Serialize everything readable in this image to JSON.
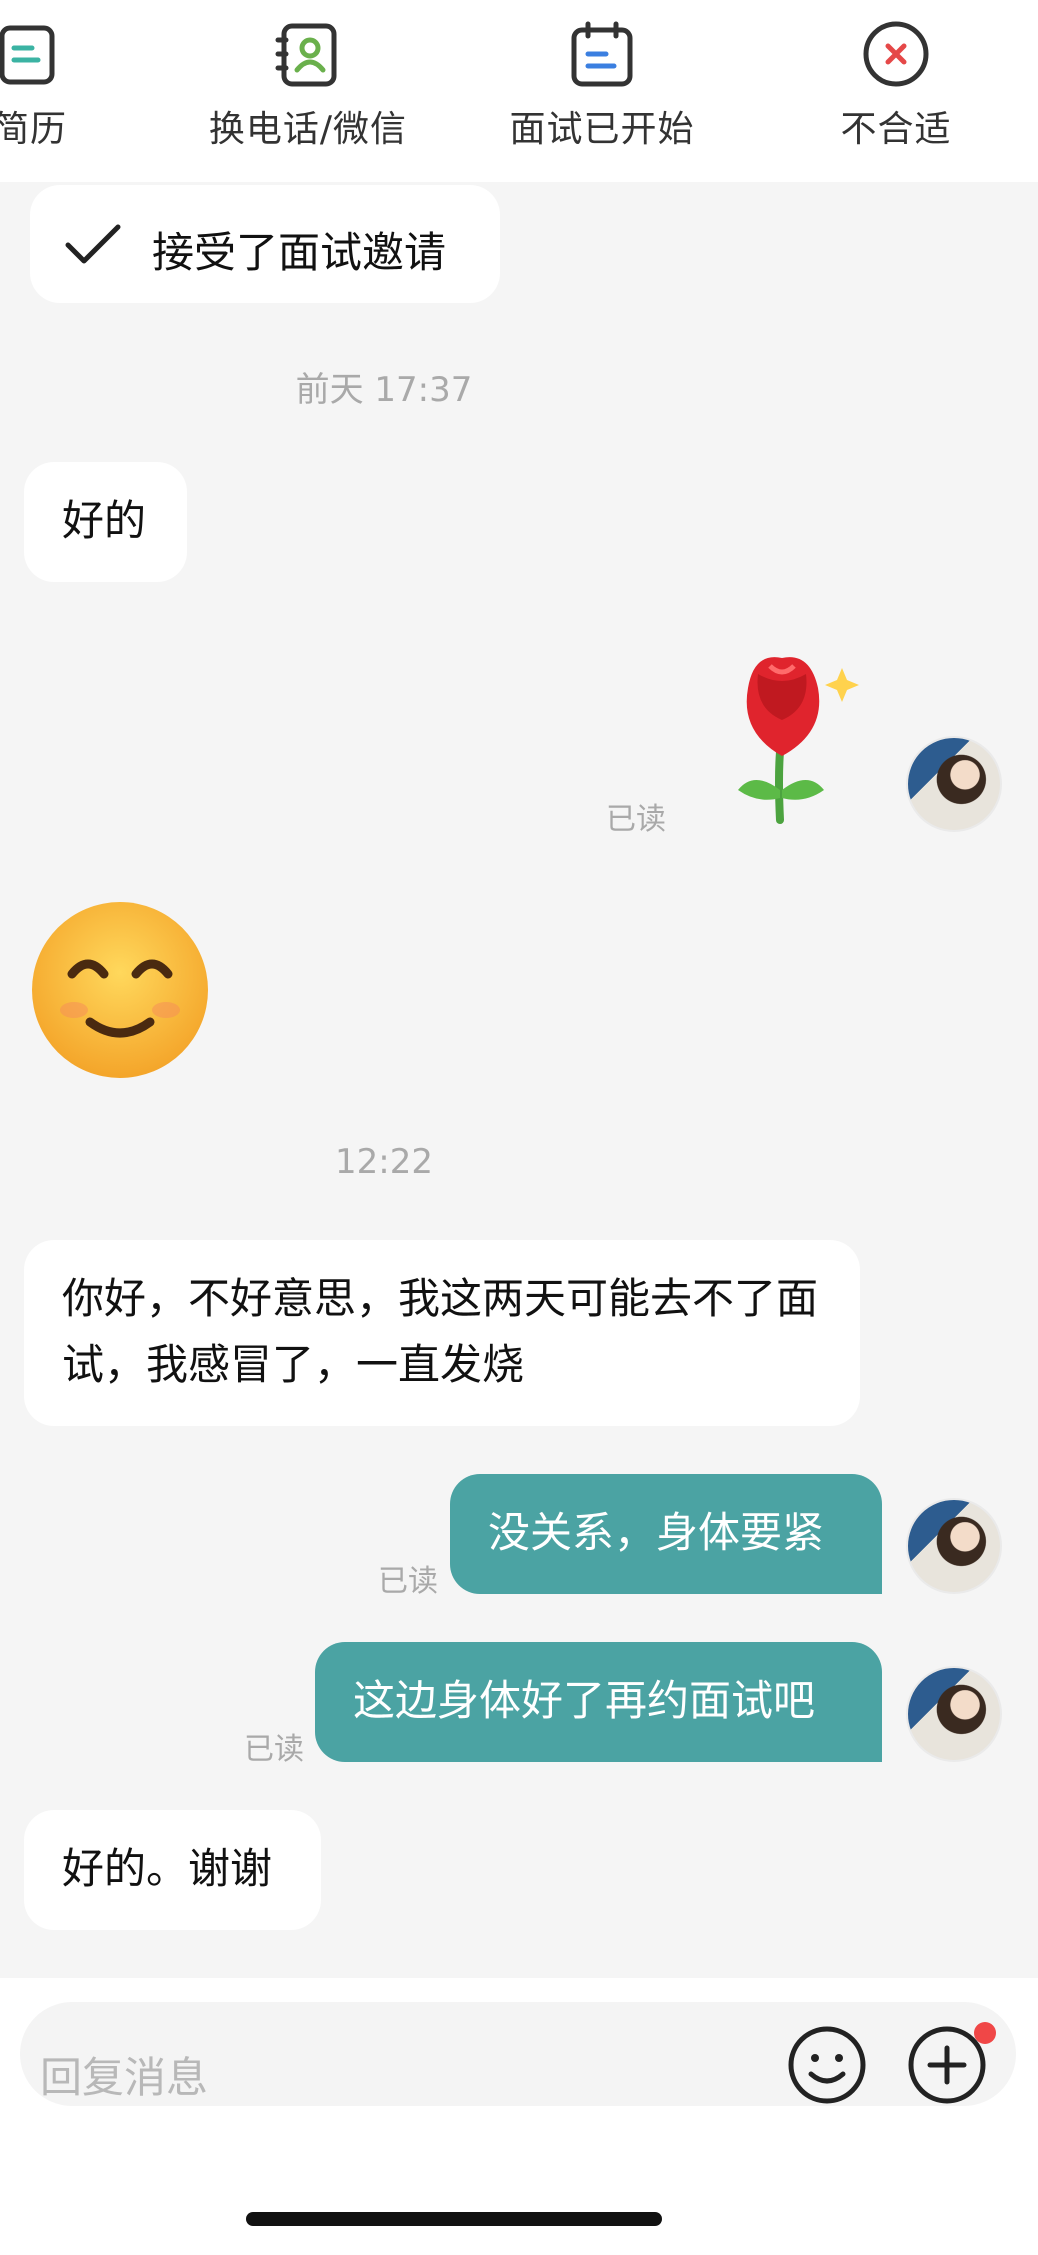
{
  "topbar": {
    "actions": [
      {
        "label": "简历",
        "icon": "resume-icon"
      },
      {
        "label": "换电话/微信",
        "icon": "contact-card-icon"
      },
      {
        "label": "面试已开始",
        "icon": "calendar-icon"
      },
      {
        "label": "不合适",
        "icon": "reject-circle-icon"
      }
    ]
  },
  "chat": {
    "system_message": "接受了面试邀请",
    "timestamps": [
      "前天 17:37",
      "12:22"
    ],
    "messages": [
      {
        "side": "left",
        "text": "好的"
      },
      {
        "side": "right",
        "type": "emoji",
        "emoji": "rose",
        "read": "已读"
      },
      {
        "side": "left",
        "type": "emoji",
        "emoji": "smiling-face"
      },
      {
        "side": "left",
        "text": "你好，不好意思，我这两天可能去不了面试，我感冒了，一直发烧"
      },
      {
        "side": "right",
        "text": "没关系，身体要紧",
        "read": "已读"
      },
      {
        "side": "right",
        "text": "这边身体好了再约面试吧",
        "read": "已读"
      },
      {
        "side": "left",
        "text": "好的。谢谢"
      }
    ]
  },
  "input": {
    "placeholder": "回复消息"
  },
  "colors": {
    "accent": "#4ba3a3",
    "background": "#f5f5f5",
    "badge": "#f04747"
  }
}
